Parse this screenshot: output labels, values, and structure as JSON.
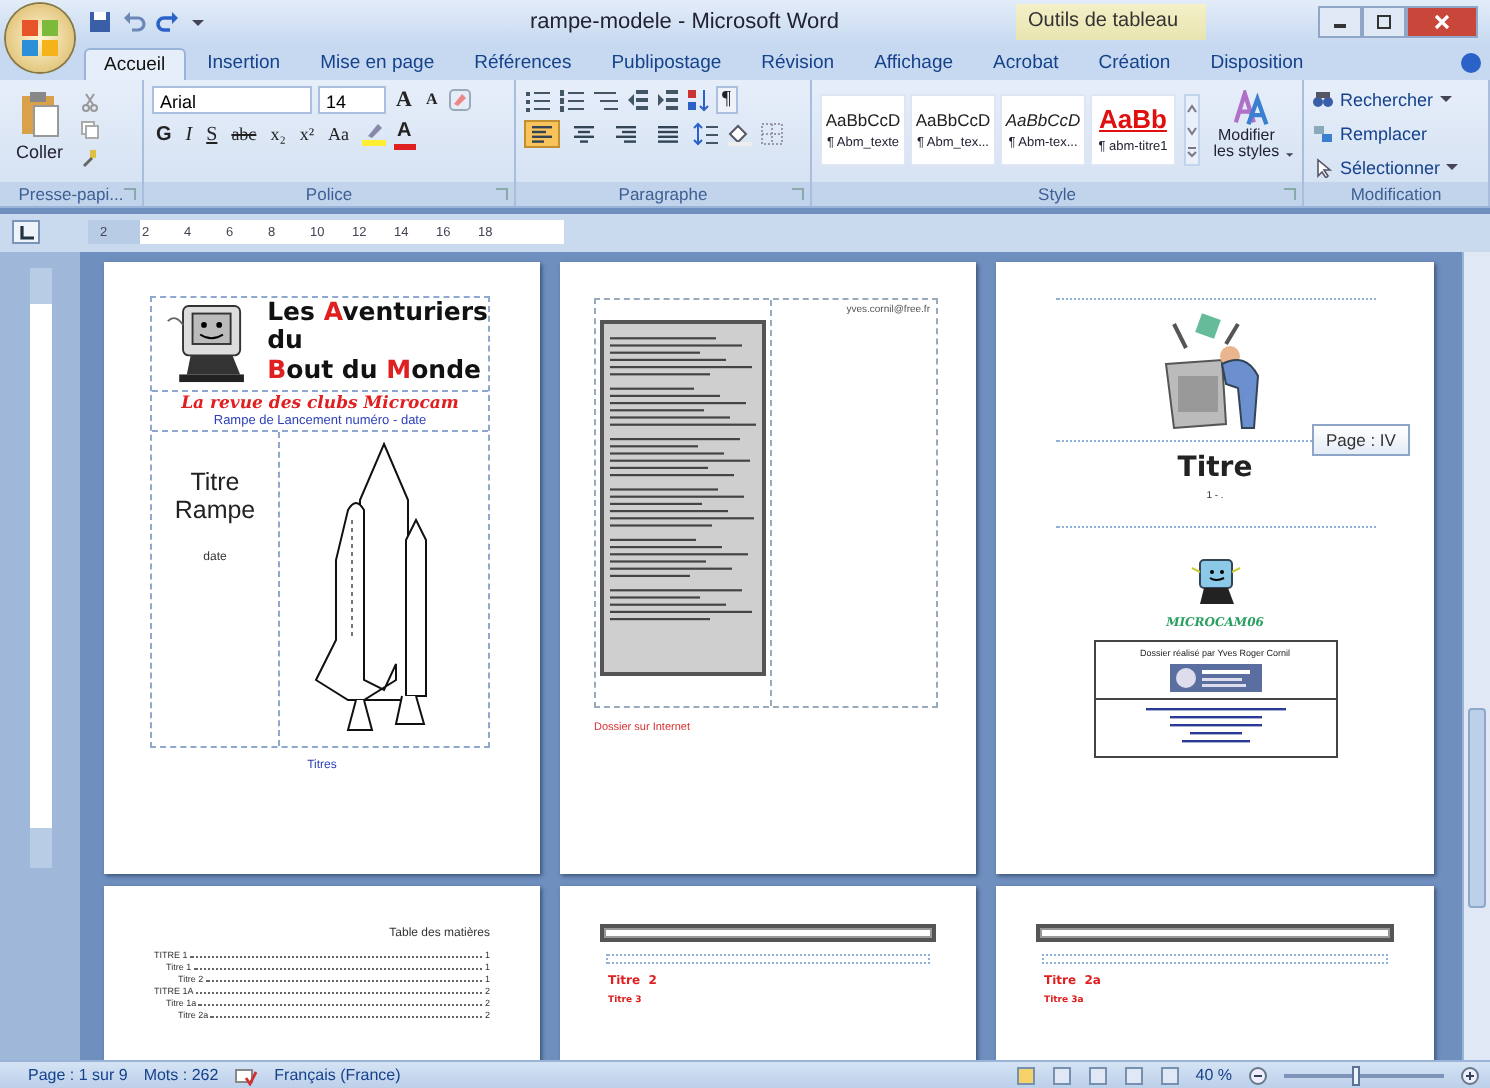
{
  "window": {
    "title": "rampe-modele - Microsoft Word",
    "context_tab": "Outils de tableau"
  },
  "tabs": [
    {
      "label": "Accueil",
      "selected": true
    },
    {
      "label": "Insertion",
      "selected": false
    },
    {
      "label": "Mise en page",
      "selected": false
    },
    {
      "label": "Références",
      "selected": false
    },
    {
      "label": "Publipostage",
      "selected": false
    },
    {
      "label": "Révision",
      "selected": false
    },
    {
      "label": "Affichage",
      "selected": false
    },
    {
      "label": "Acrobat",
      "selected": false
    },
    {
      "label": "Création",
      "selected": false
    },
    {
      "label": "Disposition",
      "selected": false
    }
  ],
  "ribbon": {
    "clipboard": {
      "paste": "Coller",
      "group": "Presse-papi..."
    },
    "font": {
      "name": "Arial",
      "size": "14",
      "grow": "A",
      "shrink": "A",
      "format_buttons": [
        {
          "kind": "bold",
          "label": "G"
        },
        {
          "kind": "italic",
          "label": "I"
        },
        {
          "kind": "underline",
          "label": "S"
        },
        {
          "kind": "strike",
          "label": "abc"
        },
        {
          "kind": "sub",
          "label": "x₂"
        },
        {
          "kind": "sup",
          "label": "x²"
        },
        {
          "kind": "case",
          "label": "Aa"
        }
      ],
      "color_label": "A",
      "group": "Police"
    },
    "paragraph": {
      "pilcrow": "¶",
      "alignments": [
        {
          "kind": "left",
          "selected": true
        },
        {
          "kind": "center",
          "selected": false
        },
        {
          "kind": "right",
          "selected": false
        },
        {
          "kind": "justify",
          "selected": false
        }
      ],
      "group": "Paragraphe"
    },
    "styles": [
      {
        "sample": "AaBbCcD",
        "name": "¶ Abm_texte",
        "kind": "normal"
      },
      {
        "sample": "AaBbCcD",
        "name": "¶ Abm_tex...",
        "kind": "normal"
      },
      {
        "sample": "AaBbCcD",
        "name": "¶ Abm-tex...",
        "kind": "italic"
      },
      {
        "sample": "AaBb",
        "name": "¶ abm-titre1",
        "kind": "heading"
      }
    ],
    "change_styles": "Modifier les styles",
    "style_group": "Style",
    "editing": [
      {
        "label": "Rechercher",
        "kind": "find",
        "dropdown": true
      },
      {
        "label": "Remplacer",
        "kind": "replace",
        "dropdown": false
      },
      {
        "label": "Sélectionner",
        "kind": "select",
        "dropdown": true
      }
    ],
    "editing_group": "Modification"
  },
  "ruler": {
    "labels": [
      "2",
      "2",
      "4",
      "6",
      "8",
      "10",
      "12",
      "14",
      "16",
      "18"
    ]
  },
  "cover": {
    "title_lines": [
      [
        {
          "t": "Les ",
          "accent": false
        },
        {
          "t": "A",
          "accent": true
        },
        {
          "t": "venturiers",
          "accent": false
        }
      ],
      [
        {
          "t": "du",
          "accent": false
        }
      ],
      [
        {
          "t": "B",
          "accent": true
        },
        {
          "t": "out du ",
          "accent": false
        },
        {
          "t": "M",
          "accent": true
        },
        {
          "t": "onde",
          "accent": false
        }
      ]
    ],
    "subtitle": "La revue des clubs Microcam",
    "issue": "Rampe de Lancement numéro  - date",
    "heading": "Titre Rampe",
    "date": "date",
    "caption": "Titres"
  },
  "page_2": {
    "email": "yves.cornil@free.fr",
    "link": "Dossier sur Internet"
  },
  "page_3": {
    "heading": "Titre",
    "number": "1 - .",
    "logo": "MICROCAM06",
    "credit": "Dossier réalisé par Yves Roger Cornil",
    "tooltip": "Page : IV"
  },
  "toc_page": {
    "title": "Table des matières",
    "entries": [
      {
        "label": "TITRE 1",
        "page": "1",
        "children": [
          {
            "label": "Titre 1",
            "page": "1",
            "children": [
              {
                "label": "Titre 2",
                "page": "1"
              }
            ]
          }
        ]
      },
      {
        "label": "TITRE 1A",
        "page": "2",
        "children": [
          {
            "label": "Titre 1a",
            "page": "2",
            "children": [
              {
                "label": "Titre 2a",
                "page": "2"
              }
            ]
          }
        ]
      }
    ]
  },
  "page_5": {
    "heading": "Titre  2",
    "subheading": "Titre 3"
  },
  "page_6": {
    "heading": "Titre  2a",
    "subheading": "Titre 3a"
  },
  "status_bar": {
    "page": "Page : 1 sur 9",
    "words": "Mots : 262",
    "language": "Français (France)",
    "zoom": "40 %",
    "zoom_slider": {
      "level": 0.45
    }
  }
}
